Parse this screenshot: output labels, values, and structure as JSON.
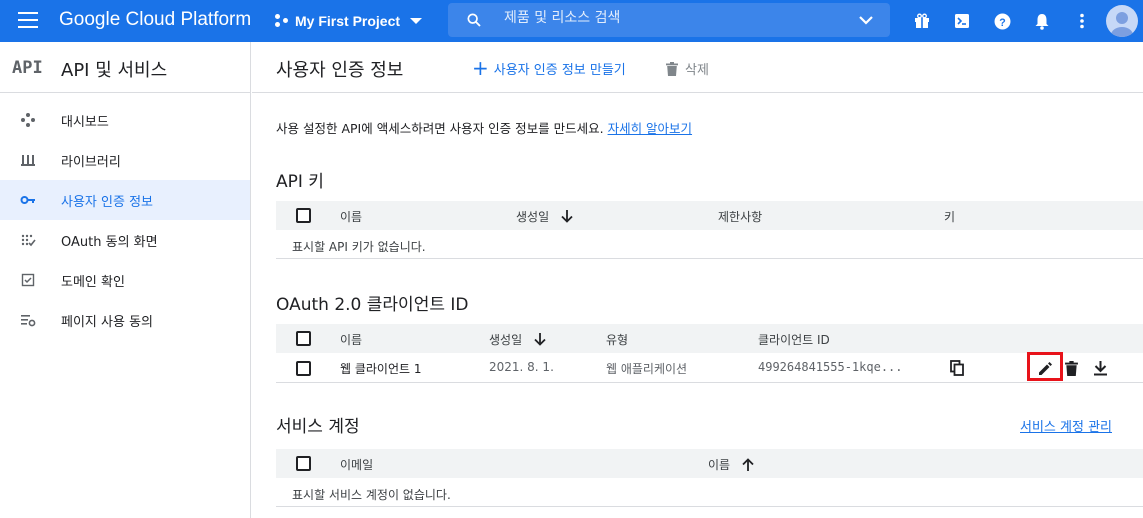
{
  "topbar": {
    "brand": "Google Cloud Platform",
    "project": "My First Project",
    "search_placeholder": "제품 및 리소스 검색"
  },
  "sidebar": {
    "logo": "API",
    "title": "API 및 서비스",
    "items": [
      {
        "label": "대시보드",
        "icon": "dashboard-icon"
      },
      {
        "label": "라이브러리",
        "icon": "library-icon"
      },
      {
        "label": "사용자 인증 정보",
        "icon": "key-icon",
        "active": true
      },
      {
        "label": "OAuth 동의 화면",
        "icon": "oauth-consent-icon"
      },
      {
        "label": "도메인 확인",
        "icon": "domain-check-icon"
      },
      {
        "label": "페이지 사용 동의",
        "icon": "page-agreement-icon"
      }
    ]
  },
  "main": {
    "title": "사용자 인증 정보",
    "create_label": "사용자 인증 정보 만들기",
    "delete_label": "삭제",
    "intro_text": "사용 설정한 API에 액세스하려면 사용자 인증 정보를 만드세요.",
    "intro_link": "자세히 알아보기",
    "api_keys": {
      "title": "API 키",
      "columns": [
        "이름",
        "생성일",
        "제한사항",
        "키"
      ],
      "empty": "표시할 API 키가 없습니다."
    },
    "oauth": {
      "title": "OAuth 2.0 클라이언트 ID",
      "columns": [
        "이름",
        "생성일",
        "유형",
        "클라이언트 ID"
      ],
      "rows": [
        {
          "name": "웹 클라이언트 1",
          "created": "2021. 8. 1.",
          "type": "웹 애플리케이션",
          "client_id": "499264841555-1kqe..."
        }
      ]
    },
    "service_accounts": {
      "title": "서비스 계정",
      "manage_link": "서비스 계정 관리",
      "columns": [
        "이메일",
        "이름"
      ],
      "empty": "표시할 서비스 계정이 없습니다."
    }
  },
  "colors": {
    "primary": "#1a73e8",
    "highlight": "#e8131a"
  }
}
